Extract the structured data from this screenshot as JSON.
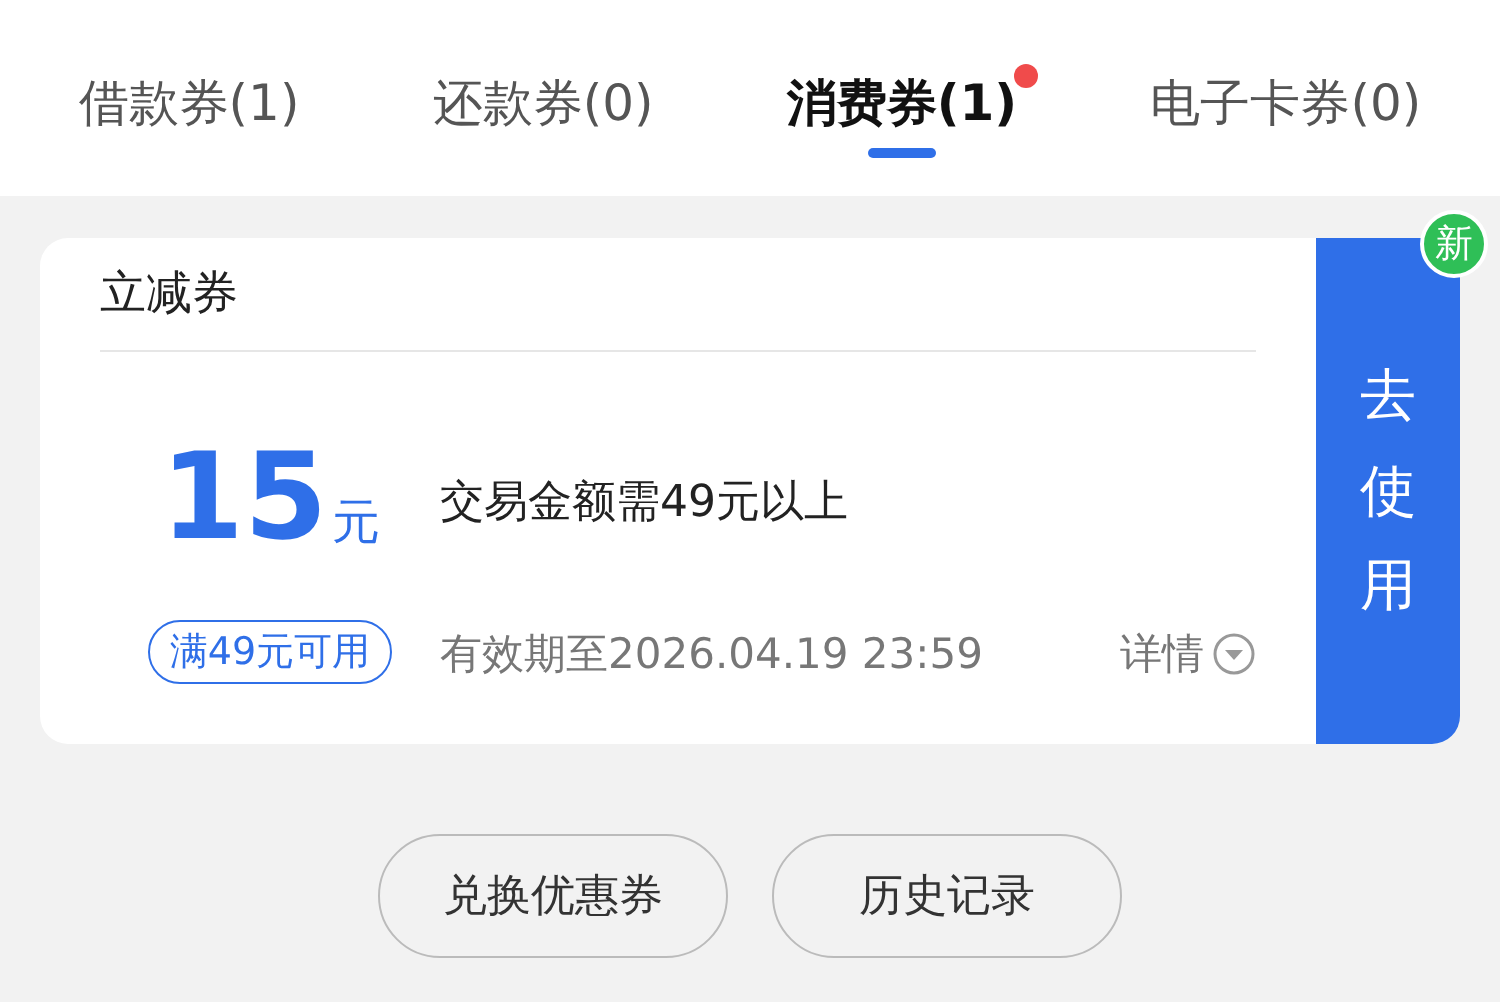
{
  "tabs": [
    {
      "label": "借款券(1)",
      "selected": false,
      "dot": false
    },
    {
      "label": "还款券(0)",
      "selected": false,
      "dot": false
    },
    {
      "label": "消费券(1)",
      "selected": true,
      "dot": true
    },
    {
      "label": "电子卡券(0)",
      "selected": false,
      "dot": false
    }
  ],
  "coupon": {
    "title": "立减券",
    "amount": "15",
    "unit": "元",
    "condition_tag": "满49元可用",
    "description": "交易金额需49元以上",
    "validity": "有效期至2026.04.19 23:59",
    "details_link": "详情",
    "action": "去使用",
    "badge": "新"
  },
  "buttons": [
    "兑换优惠券",
    "历史记录"
  ]
}
